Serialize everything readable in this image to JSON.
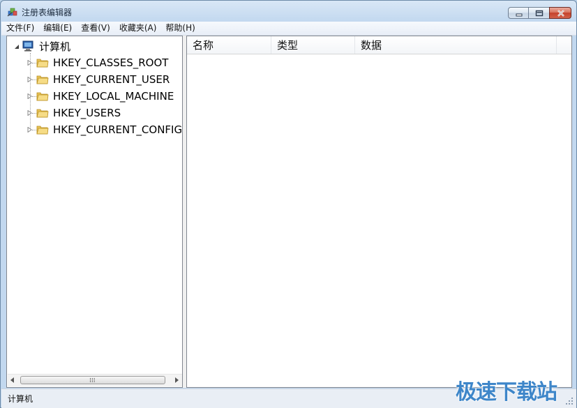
{
  "window": {
    "title": "注册表编辑器"
  },
  "menu": [
    "文件(F)",
    "编辑(E)",
    "查看(V)",
    "收藏夹(A)",
    "帮助(H)"
  ],
  "tree": {
    "root": "计算机",
    "items": [
      {
        "label": "HKEY_CLASSES_ROOT",
        "icon": "folder-icon"
      },
      {
        "label": "HKEY_CURRENT_USER",
        "icon": "folder-icon"
      },
      {
        "label": "HKEY_LOCAL_MACHINE",
        "icon": "folder-icon"
      },
      {
        "label": "HKEY_USERS",
        "icon": "folder-icon"
      },
      {
        "label": "HKEY_CURRENT_CONFIG",
        "icon": "folder-icon"
      }
    ]
  },
  "list": {
    "columns": [
      "名称",
      "类型",
      "数据"
    ]
  },
  "status": {
    "path": "计算机"
  },
  "watermark": "极速下载站",
  "colors": {
    "accent": "#3e86c9",
    "close_button": "#c4412b",
    "folder": "#e8c45a"
  }
}
